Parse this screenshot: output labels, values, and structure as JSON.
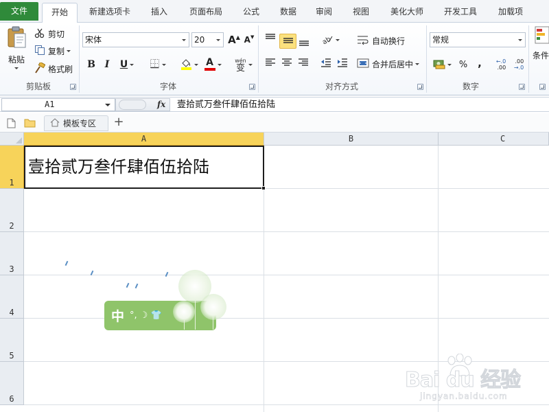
{
  "ribbon_tabs": [
    {
      "label": "文件"
    },
    {
      "label": "开始"
    },
    {
      "label": "新建选项卡"
    },
    {
      "label": "插入"
    },
    {
      "label": "页面布局"
    },
    {
      "label": "公式"
    },
    {
      "label": "数据"
    },
    {
      "label": "审阅"
    },
    {
      "label": "视图"
    },
    {
      "label": "美化大师"
    },
    {
      "label": "开发工具"
    },
    {
      "label": "加载项"
    }
  ],
  "active_tab": "开始",
  "clipboard": {
    "paste_label": "粘贴",
    "cut_label": "剪切",
    "copy_label": "复制",
    "format_painter_label": "格式刷",
    "group_label": "剪贴板"
  },
  "font": {
    "font_name": "宋体",
    "font_size": "20",
    "grow_label": "A",
    "shrink_label": "A",
    "bold_label": "B",
    "italic_label": "I",
    "underline_label": "U",
    "font_color_label": "A",
    "phonetic_label": "wén",
    "phonetic_char": "变",
    "group_label": "字体",
    "highlight_color": "#ffff00",
    "font_color": "#e00000"
  },
  "alignment": {
    "wrap_text_label": "自动换行",
    "merge_center_label": "合并后居中",
    "group_label": "对齐方式"
  },
  "number": {
    "format_value": "常规",
    "percent_label": "%",
    "comma_label": ",",
    "inc_decimal_top": "←.0",
    "inc_decimal_bottom": ".00",
    "dec_decimal_top": ".00",
    "dec_decimal_bottom": "→.0",
    "group_label": "数字"
  },
  "styles": {
    "conditional_label": "条件"
  },
  "formula_bar": {
    "name_box": "A1",
    "fx_label": "fx",
    "content": "壹拾贰万叁仟肆佰伍拾陆"
  },
  "doc_tabs": {
    "template_tab": "模板专区",
    "add_label": "+"
  },
  "sheet": {
    "columns": [
      "A",
      "B",
      "C"
    ],
    "rows": [
      "1",
      "2",
      "3",
      "4",
      "5",
      "6"
    ],
    "selected_cell": "A1",
    "a1_value": "壹拾贰万叁仟肆佰伍拾陆"
  },
  "ime": {
    "mode_char": "中",
    "symbols": "°, ☽ 👕"
  },
  "watermark": {
    "brand": "Bai du 经验",
    "url": "jingyan.baidu.com"
  }
}
